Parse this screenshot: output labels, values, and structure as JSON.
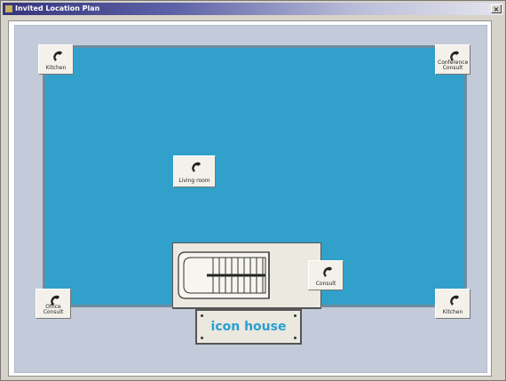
{
  "window": {
    "title": "Invited Location Plan",
    "close_label": "×"
  },
  "locations": [
    {
      "id": "loc-top-left",
      "label": "Kitchen"
    },
    {
      "id": "loc-top-right",
      "label": "Conference Consult"
    },
    {
      "id": "loc-center",
      "label": "Living room"
    },
    {
      "id": "loc-stair-right",
      "label": "Consult"
    },
    {
      "id": "loc-bottom-left",
      "label": "Office Consult"
    },
    {
      "id": "loc-bottom-right",
      "label": "Kitchen"
    }
  ],
  "sign": {
    "text": "icon house"
  },
  "icons": {
    "location": "telephone-handset-icon"
  },
  "colors": {
    "room_fill": "#31a0cb",
    "panel_fill": "#c3cad9",
    "sign_text": "#2a9fd0"
  }
}
